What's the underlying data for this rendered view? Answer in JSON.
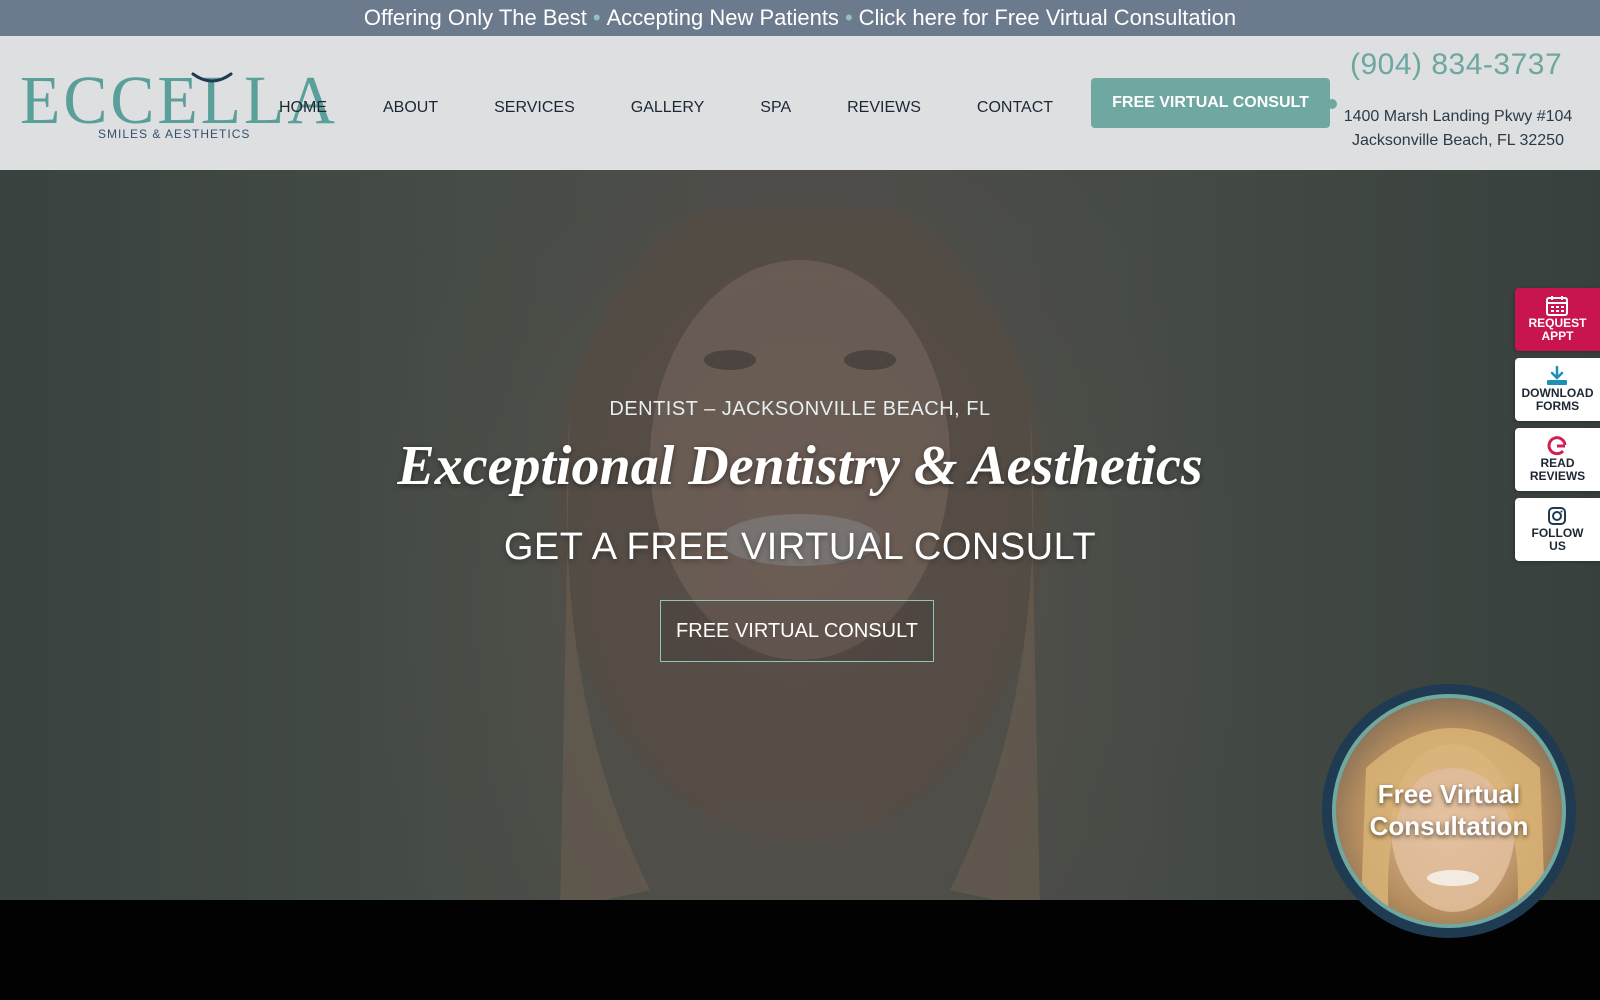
{
  "topbar": {
    "part1": "Offering Only The Best",
    "separator": "•",
    "part2": "Accepting New Patients",
    "part3": "Click here for Free Virtual Consultation"
  },
  "logo": {
    "wordmark": "ECCELLA",
    "tagline": "SMILES & AESTHETICS"
  },
  "nav": {
    "items": [
      "HOME",
      "ABOUT",
      "SERVICES",
      "GALLERY",
      "SPA",
      "REVIEWS",
      "CONTACT"
    ]
  },
  "header": {
    "cta_label": "FREE VIRTUAL CONSULT",
    "phone": "(904) 834-3737",
    "address_line1": "1400 Marsh Landing Pkwy #104",
    "address_line2": "Jacksonville Beach, FL 32250"
  },
  "hero": {
    "eyebrow": "DENTIST – JACKSONVILLE BEACH, FL",
    "title": "Exceptional Dentistry & Aesthetics",
    "subtitle": "GET A FREE VIRTUAL CONSULT",
    "button_label": "FREE VIRTUAL CONSULT"
  },
  "side_links": [
    {
      "line1": "REQUEST",
      "line2": "APPT",
      "icon": "calendar-icon"
    },
    {
      "line1": "DOWNLOAD",
      "line2": "FORMS",
      "icon": "download-icon"
    },
    {
      "line1": "READ",
      "line2": "REVIEWS",
      "icon": "google-icon"
    },
    {
      "line1": "FOLLOW",
      "line2": "US",
      "icon": "instagram-icon"
    }
  ],
  "bubble": {
    "line1": "Free Virtual",
    "line2": "Consultation"
  },
  "colors": {
    "accent": "#6fa7a1",
    "topbar": "#6c7a8d",
    "request_appt": "#c8154f",
    "bubble_ring": "#1f3b52"
  }
}
